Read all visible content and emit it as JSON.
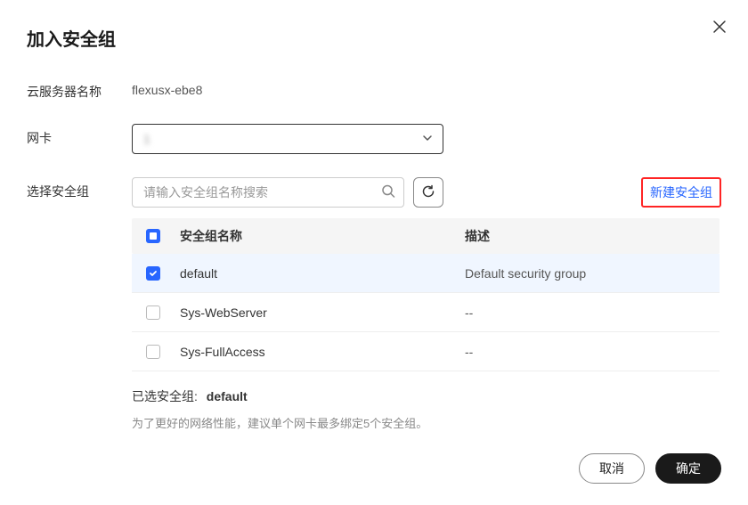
{
  "dialog": {
    "title": "加入安全组",
    "close_label": "×"
  },
  "server": {
    "label": "云服务器名称",
    "value": "flexusx-ebe8"
  },
  "nic": {
    "label": "网卡",
    "selected_display": "1"
  },
  "sg": {
    "label": "选择安全组",
    "search_placeholder": "请输入安全组名称搜索",
    "create_link": "新建安全组",
    "columns": {
      "name": "安全组名称",
      "desc": "描述"
    },
    "rows": [
      {
        "name": "default",
        "desc": "Default security group",
        "checked": true
      },
      {
        "name": "Sys-WebServer",
        "desc": "--",
        "checked": false
      },
      {
        "name": "Sys-FullAccess",
        "desc": "--",
        "checked": false
      }
    ],
    "selected_prefix": "已选安全组:",
    "selected_value": "default",
    "hint": "为了更好的网络性能，建议单个网卡最多绑定5个安全组。"
  },
  "footer": {
    "cancel": "取消",
    "confirm": "确定"
  }
}
